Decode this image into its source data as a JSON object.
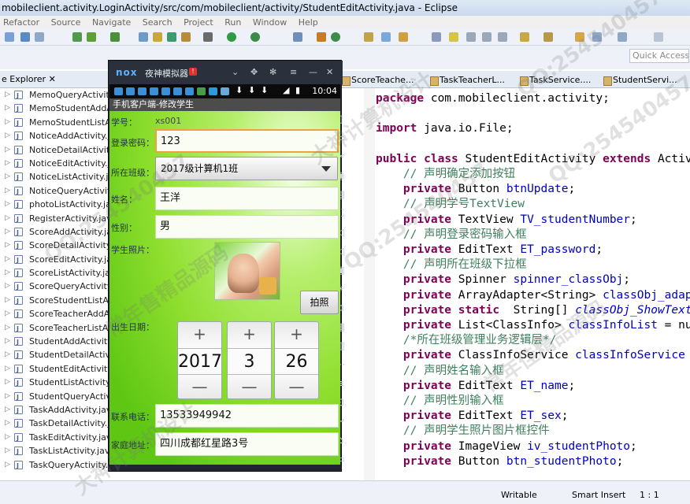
{
  "window": {
    "title": "mobileclient.activity.LoginActivity/src/com/mobileclient/activity/StudentEditActivity.java - Eclipse"
  },
  "menu": [
    "Refactor",
    "Source",
    "Navigate",
    "Search",
    "Project",
    "Run",
    "Window",
    "Help"
  ],
  "quick_access": {
    "placeholder": "Quick Access"
  },
  "package_explorer": {
    "tab_label": "e Explorer",
    "files": [
      "MemoQueryActivity.j",
      "MemoStudentAddAct",
      "MemoStudentListAct",
      "NoticeAddActivity.ja",
      "NoticeDetailActivity.",
      "NoticeEditActivity.ja",
      "NoticeListActivity.jav",
      "NoticeQueryActivity.j",
      "photoListActivity.java",
      "RegisterActivity.java",
      "ScoreAddActivity.java",
      "ScoreDetailActivity.ja",
      "ScoreEditActivity.java",
      "ScoreListActivity.java",
      "ScoreQueryActivity.ja",
      "ScoreStudentListActi",
      "ScoreTeacherAddAct",
      "ScoreTeacherListAct",
      "StudentAddActivity.ja",
      "StudentDetailActivity",
      "StudentEditActivity.ja",
      "StudentListActivity.ja",
      "StudentQueryActivity",
      "TaskAddActivity.java",
      "TaskDetailActivity.ja",
      "TaskEditActivity.java",
      "TaskListActivity.java",
      "TaskQueryActivity.java"
    ]
  },
  "editor_tabs": [
    "ScoreTeache...",
    "TaskTeacherL...",
    "TaskService....",
    "StudentServi..."
  ],
  "code": [
    [
      {
        "t": "package",
        "c": "kw"
      },
      {
        "t": " com.mobileclient.activity;"
      }
    ],
    [],
    [
      {
        "t": "import",
        "c": "kw"
      },
      {
        "t": " java.io.File;"
      }
    ],
    [],
    [
      {
        "t": "public",
        "c": "kw"
      },
      {
        "t": " "
      },
      {
        "t": "class",
        "c": "kw"
      },
      {
        "t": " StudentEditActivity "
      },
      {
        "t": "extends",
        "c": "kw"
      },
      {
        "t": " Activ"
      }
    ],
    [
      {
        "t": "    // 声明确定添加按钮",
        "c": "cm"
      }
    ],
    [
      {
        "t": "    "
      },
      {
        "t": "private",
        "c": "kw"
      },
      {
        "t": " Button "
      },
      {
        "t": "btnUpdate",
        "c": "fd"
      },
      {
        "t": ";"
      }
    ],
    [
      {
        "t": "    // 声明学号TextView",
        "c": "cm"
      }
    ],
    [
      {
        "t": "    "
      },
      {
        "t": "private",
        "c": "kw"
      },
      {
        "t": " TextView "
      },
      {
        "t": "TV_studentNumber",
        "c": "fd"
      },
      {
        "t": ";"
      }
    ],
    [
      {
        "t": "    // 声明登录密码输入框",
        "c": "cm"
      }
    ],
    [
      {
        "t": "    "
      },
      {
        "t": "private",
        "c": "kw"
      },
      {
        "t": " EditText "
      },
      {
        "t": "ET_password",
        "c": "fd"
      },
      {
        "t": ";"
      }
    ],
    [
      {
        "t": "    // 声明所在班级下拉框",
        "c": "cm"
      }
    ],
    [
      {
        "t": "    "
      },
      {
        "t": "private",
        "c": "kw"
      },
      {
        "t": " Spinner "
      },
      {
        "t": "spinner_classObj",
        "c": "fd"
      },
      {
        "t": ";"
      }
    ],
    [
      {
        "t": "    "
      },
      {
        "t": "private",
        "c": "kw"
      },
      {
        "t": " ArrayAdapter<String> "
      },
      {
        "t": "classObj_adap",
        "c": "fd"
      }
    ],
    [
      {
        "t": "    "
      },
      {
        "t": "private",
        "c": "kw"
      },
      {
        "t": " "
      },
      {
        "t": "static",
        "c": "kw"
      },
      {
        "t": "  String[] "
      },
      {
        "t": "classObj_ShowText",
        "c": "fd it"
      }
    ],
    [
      {
        "t": "    "
      },
      {
        "t": "private",
        "c": "kw"
      },
      {
        "t": " List<ClassInfo> "
      },
      {
        "t": "classInfoList",
        "c": "fd"
      },
      {
        "t": " = nu"
      }
    ],
    [
      {
        "t": "    /*所在班级管理业务逻辑层*/",
        "c": "cm"
      }
    ],
    [
      {
        "t": "    "
      },
      {
        "t": "private",
        "c": "kw"
      },
      {
        "t": " ClassInfoService "
      },
      {
        "t": "classInfoService",
        "c": "fd"
      }
    ],
    [
      {
        "t": "    // 声明姓名输入框",
        "c": "cm"
      }
    ],
    [
      {
        "t": "    "
      },
      {
        "t": "private",
        "c": "kw"
      },
      {
        "t": " EditText "
      },
      {
        "t": "ET_name",
        "c": "fd"
      },
      {
        "t": ";"
      }
    ],
    [
      {
        "t": "    // 声明性别输入框",
        "c": "cm"
      }
    ],
    [
      {
        "t": "    "
      },
      {
        "t": "private",
        "c": "kw"
      },
      {
        "t": " EditText "
      },
      {
        "t": "ET_sex",
        "c": "fd"
      },
      {
        "t": ";"
      }
    ],
    [
      {
        "t": "    // 声明学生照片图片框控件",
        "c": "cm"
      }
    ],
    [
      {
        "t": "    "
      },
      {
        "t": "private",
        "c": "kw"
      },
      {
        "t": " ImageView "
      },
      {
        "t": "iv_studentPhoto",
        "c": "fd"
      },
      {
        "t": ";"
      }
    ],
    [
      {
        "t": "    "
      },
      {
        "t": "private",
        "c": "kw"
      },
      {
        "t": " Button "
      },
      {
        "t": "btn_studentPhoto",
        "c": "fd"
      },
      {
        "t": ";"
      }
    ]
  ],
  "status": {
    "writable": "Writable",
    "insert_mode": "Smart Insert",
    "position": "1 : 1"
  },
  "emulator": {
    "logo": "nox",
    "title": "夜神模拟器",
    "badge": "!",
    "clock": "10:04",
    "app": {
      "title": "手机客户端-修改学生",
      "student_number_label": "学号：",
      "student_number": "xs001",
      "password_label": "登录密码：",
      "password": "123",
      "class_label": "所在班级：",
      "class_value": "2017级计算机1班",
      "name_label": "姓名：",
      "name": "王洋",
      "sex_label": "性别：",
      "sex": "男",
      "photo_label": "学生照片：",
      "photo_button": "拍照",
      "birthday_label": "出生日期：",
      "date": {
        "year": "2017",
        "month": "3",
        "day": "26",
        "plus": "+",
        "minus": "—"
      },
      "phone_label": "联系电话：",
      "phone": "13533949942",
      "address_label": "家庭地址：",
      "address": "四川成都红星路3号"
    }
  },
  "watermarks": [
    "QQ:254540457",
    "常年售精品源码",
    "大神计算机设计",
    "QQ:254540457",
    "常年佳精品源码",
    "QQ:254540457",
    "大神计算机设计",
    "QQ:254540457"
  ]
}
